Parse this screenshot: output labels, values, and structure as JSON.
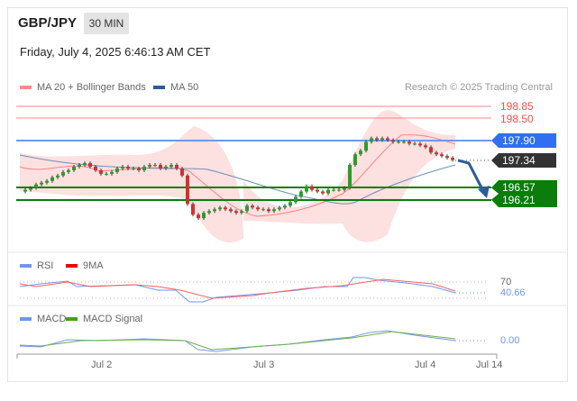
{
  "header": {
    "symbol": "GBP/JPY",
    "timeframe": "30 MIN",
    "datetime": "Friday, July 4, 2025 6:46:13 AM CET"
  },
  "legend": {
    "ma20": "MA 20 + Bollinger Bands",
    "ma50": "MA 50",
    "credit": "Research © 2025 Trading Central"
  },
  "levels": {
    "r2": "198.85",
    "r1": "198.50",
    "pivot": "197.90",
    "last": "197.34",
    "s1": "196.57",
    "s2": "196.21"
  },
  "rsi": {
    "label": "RSI",
    "ma_label": "9MA",
    "level": "70",
    "value": "40.66"
  },
  "macd": {
    "label": "MACD",
    "signal_label": "MACD Signal",
    "value": "0.00"
  },
  "colors": {
    "red": "#ff6b6b",
    "blue": "#3a6fe8",
    "green": "#0a7d0a",
    "dark": "#333333"
  },
  "chart_data": {
    "type": "candlestick",
    "title": "GBP/JPY 30 MIN",
    "x_ticks": [
      "Jul 2",
      "Jul 3",
      "Jul 4",
      "Jul 14"
    ],
    "ylim": [
      195.5,
      199.0
    ],
    "closes": [
      196.45,
      196.5,
      196.55,
      196.65,
      196.7,
      196.75,
      196.85,
      196.9,
      197.0,
      197.05,
      197.15,
      197.2,
      197.25,
      197.15,
      197.05,
      196.95,
      196.95,
      197.0,
      197.1,
      197.15,
      197.1,
      197.1,
      197.05,
      197.15,
      197.2,
      197.2,
      197.1,
      197.15,
      197.2,
      197.1,
      196.9,
      196.1,
      195.8,
      195.7,
      195.85,
      195.9,
      195.95,
      196.0,
      195.95,
      195.9,
      195.85,
      195.9,
      196.05,
      196.0,
      195.95,
      195.95,
      195.9,
      195.95,
      196.0,
      196.05,
      196.15,
      196.3,
      196.45,
      196.6,
      196.5,
      196.45,
      196.4,
      196.5,
      196.5,
      196.5,
      196.55,
      197.2,
      197.5,
      197.6,
      197.85,
      197.95,
      197.9,
      197.95,
      197.9,
      197.85,
      197.85,
      197.85,
      197.8,
      197.8,
      197.75,
      197.7,
      197.55,
      197.5,
      197.45,
      197.4,
      197.34
    ],
    "horizontal_levels": [
      198.85,
      198.5,
      197.9,
      197.34,
      196.57,
      196.21
    ],
    "forecast": "down toward 196.57"
  }
}
